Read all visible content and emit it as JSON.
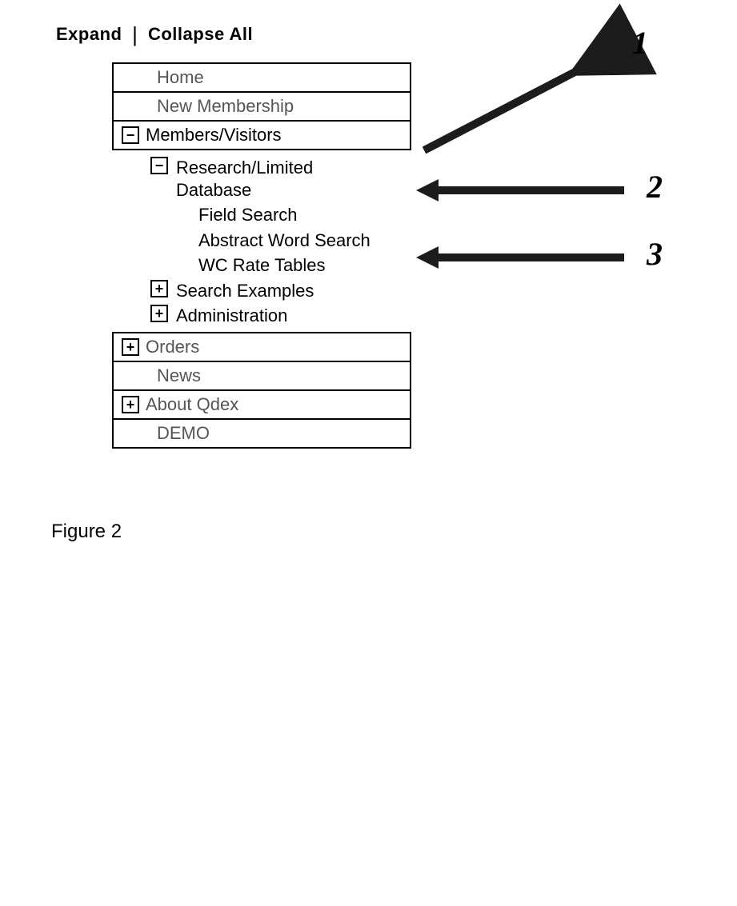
{
  "header": {
    "expand_label": "Expand",
    "collapse_label": "Collapse All"
  },
  "tree": {
    "box_top": [
      {
        "icon": "none",
        "label": "Home"
      },
      {
        "icon": "none",
        "label": "New Membership"
      },
      {
        "icon": "minus",
        "label": "Members/Visitors",
        "selected": true
      }
    ],
    "children_level1": [
      {
        "icon": "minus",
        "label": "Research/Limited Database",
        "children": [
          {
            "label": "Field Search"
          },
          {
            "label": "Abstract Word Search"
          },
          {
            "label": "WC Rate Tables"
          }
        ]
      },
      {
        "icon": "plus",
        "label": "Search Examples"
      },
      {
        "icon": "plus",
        "label": "Administration"
      }
    ],
    "box_bottom": [
      {
        "icon": "plus",
        "label": "Orders"
      },
      {
        "icon": "none",
        "label": "News"
      },
      {
        "icon": "plus",
        "label": "About Qdex"
      },
      {
        "icon": "none",
        "label": "DEMO"
      }
    ]
  },
  "callouts": [
    {
      "number": "1",
      "target": "Members/Visitors"
    },
    {
      "number": "2",
      "target": "Research/Limited Database"
    },
    {
      "number": "3",
      "target": "Field Search"
    }
  ],
  "caption": "Figure 2",
  "icons": {
    "plus": "+",
    "minus": "−"
  }
}
